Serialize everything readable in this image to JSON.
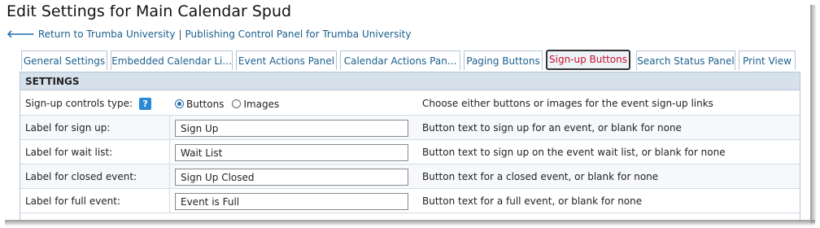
{
  "page_title": "Edit Settings for Main Calendar Spud",
  "breadcrumb": {
    "back_link": "Return to Trumba University",
    "separator": "|",
    "panel_link": "Publishing Control Panel for Trumba University"
  },
  "tabs": [
    {
      "label": "General Settings",
      "active": false
    },
    {
      "label": "Embedded Calendar Li...",
      "active": false
    },
    {
      "label": "Event Actions Panel",
      "active": false
    },
    {
      "label": "Calendar Actions Pan...",
      "active": false
    },
    {
      "label": "Paging Buttons",
      "active": false
    },
    {
      "label": "Sign-up Buttons",
      "active": true
    },
    {
      "label": "Search Status Panel",
      "active": false
    },
    {
      "label": "Print View",
      "active": false
    }
  ],
  "settings": {
    "section_title": "SETTINGS",
    "controls_type": {
      "label": "Sign-up controls type:",
      "help_icon": "?",
      "options": [
        "Buttons",
        "Images"
      ],
      "selected": "Buttons",
      "description": "Choose either buttons or images for the event sign-up links"
    },
    "rows": [
      {
        "label": "Label for sign up:",
        "value": "Sign Up",
        "description": "Button text to sign up for an event, or blank for none"
      },
      {
        "label": "Label for wait list:",
        "value": "Wait List",
        "description": "Button text to sign up on the event wait list, or blank for none"
      },
      {
        "label": "Label for closed event:",
        "value": "Sign Up Closed",
        "description": "Button text for a closed event, or blank for none"
      },
      {
        "label": "Label for full event:",
        "value": "Event is Full",
        "description": "Button text for a full event, or blank for none"
      }
    ]
  },
  "colors": {
    "link": "#1a5f8c",
    "active_tab_text": "#c8102e",
    "section_header_bg": "#d6e1ec",
    "help_icon_bg": "#2b8ad6"
  },
  "icons": {
    "back": "left-arrow-icon",
    "help": "question-icon"
  }
}
